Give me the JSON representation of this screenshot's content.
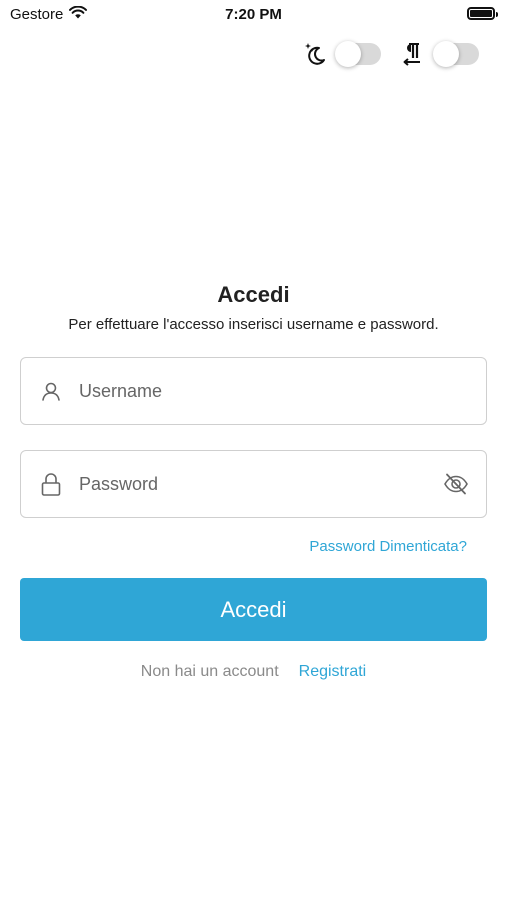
{
  "status_bar": {
    "carrier": "Gestore",
    "time": "7:20 PM",
    "battery_level": 1.0
  },
  "toolbar": {
    "dark_mode_toggle": {
      "icon": "moon-stars-icon",
      "on": false
    },
    "text_direction_toggle": {
      "icon": "paragraph-direction-icon",
      "on": false
    }
  },
  "login": {
    "title": "Accedi",
    "subtitle": "Per effettuare l'accesso inserisci username e password.",
    "username_placeholder": "Username",
    "username_value": "",
    "password_placeholder": "Password",
    "password_value": "",
    "forgot_password": "Password Dimenticata?",
    "submit_label": "Accedi",
    "no_account_text": "Non hai un account",
    "register_link": "Registrati"
  },
  "colors": {
    "accent": "#2fa6d6",
    "muted_text": "#8a8a8a",
    "border": "#cfcfcf",
    "toggle_track": "#d9d9d9"
  }
}
